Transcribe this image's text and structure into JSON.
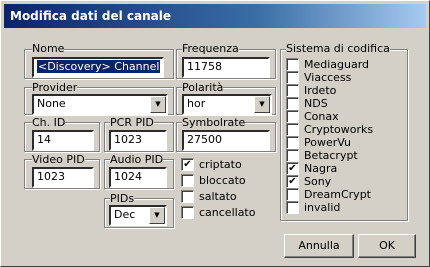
{
  "window": {
    "title": "Modifica dati del canale"
  },
  "fields": {
    "nome": {
      "label": "Nome",
      "value": "<Discovery> Channel"
    },
    "frequenza": {
      "label": "Frequenza",
      "value": "11758"
    },
    "provider": {
      "label": "Provider",
      "value": "None"
    },
    "polarita": {
      "label": "Polarità",
      "value": "hor"
    },
    "ch_id": {
      "label": "Ch. ID",
      "value": "14"
    },
    "pcr_pid": {
      "label": "PCR PID",
      "value": "1023"
    },
    "symbolrate": {
      "label": "Symbolrate",
      "value": "27500"
    },
    "video_pid": {
      "label": "Video PID",
      "value": "1023"
    },
    "audio_pid": {
      "label": "Audio PID",
      "value": "1024"
    },
    "pids": {
      "label": "PIDs",
      "value": "Dec"
    }
  },
  "flags": [
    {
      "label": "criptato",
      "checked": true
    },
    {
      "label": "bloccato",
      "checked": false
    },
    {
      "label": "saltato",
      "checked": false
    },
    {
      "label": "cancellato",
      "checked": false
    }
  ],
  "encoding": {
    "title": "Sistema di codifica",
    "systems": [
      {
        "label": "Mediaguard",
        "checked": false
      },
      {
        "label": "Viaccess",
        "checked": false
      },
      {
        "label": "Irdeto",
        "checked": false
      },
      {
        "label": "NDS",
        "checked": false
      },
      {
        "label": "Conax",
        "checked": false
      },
      {
        "label": "Cryptoworks",
        "checked": false
      },
      {
        "label": "PowerVu",
        "checked": false
      },
      {
        "label": "Betacrypt",
        "checked": false
      },
      {
        "label": "Nagra",
        "checked": true
      },
      {
        "label": "Sony",
        "checked": true
      },
      {
        "label": "DreamCrypt",
        "checked": false
      },
      {
        "label": "invalid",
        "checked": false
      }
    ]
  },
  "buttons": {
    "cancel": "Annulla",
    "ok": "OK"
  },
  "icons": {
    "dropdown": "chevron-down-icon",
    "check": "check-icon"
  },
  "colors": {
    "titlebar_start": "#0a246a",
    "titlebar_end": "#a6caf0",
    "face": "#d4d0c8",
    "selection": "#0a246a"
  }
}
